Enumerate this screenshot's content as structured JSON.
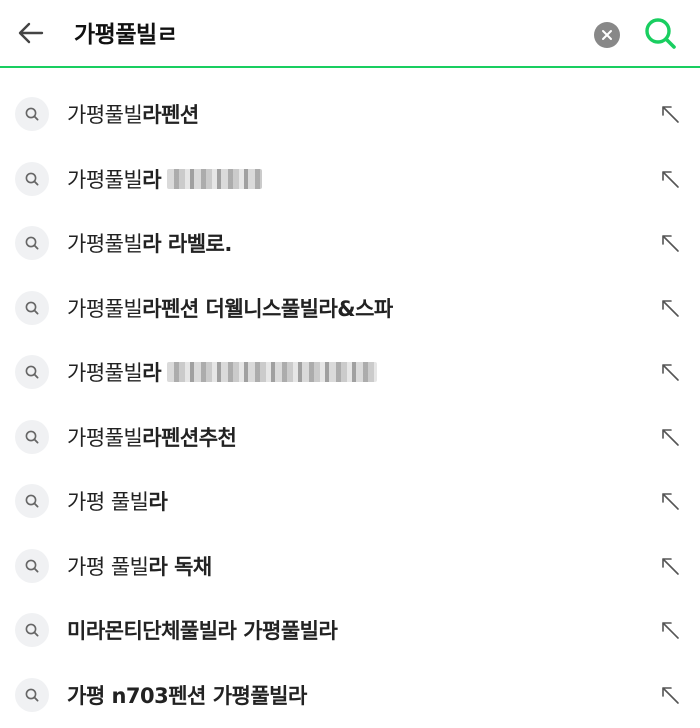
{
  "search": {
    "query": "가평풀빌ㄹ",
    "accent_color": "#19ce60",
    "back_icon": "arrow-left-icon",
    "clear_icon": "clear-icon",
    "submit_icon": "search-icon"
  },
  "suggestions": [
    {
      "prefix": "가평풀빌",
      "bold": "",
      "text": "라펜션",
      "masked": false
    },
    {
      "prefix": "가평풀빌",
      "bold": "",
      "text": "라",
      "masked": true
    },
    {
      "prefix": "가평풀빌",
      "bold": "",
      "text": "라 라벨로.",
      "masked": false
    },
    {
      "prefix": "가평풀빌",
      "bold": "",
      "text": "라펜션 더웰니스풀빌라&스파",
      "masked": false
    },
    {
      "prefix": "가평풀빌",
      "bold": "",
      "text": "라",
      "masked": true
    },
    {
      "prefix": "가평풀빌",
      "bold": "",
      "text": "라펜션추천",
      "masked": false
    },
    {
      "prefix": "가평 풀빌",
      "bold": "",
      "text": "라",
      "masked": false
    },
    {
      "prefix": "가평 풀빌",
      "bold": "",
      "text": "라 독채",
      "masked": false
    },
    {
      "prefix": "",
      "bold": "미라몬티단체풀빌라",
      "text": " 가평풀빌라",
      "masked": false
    },
    {
      "prefix": "",
      "bold": "가평 n703펜션",
      "text": " 가평풀빌라",
      "masked": false
    }
  ]
}
